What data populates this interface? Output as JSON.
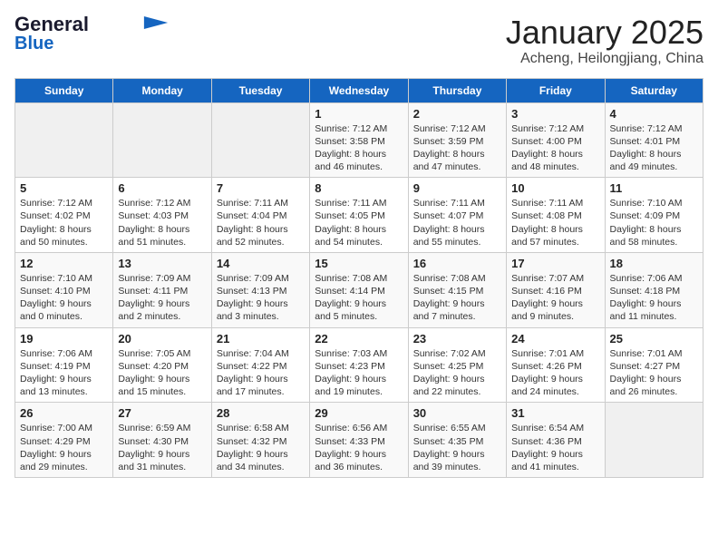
{
  "logo": {
    "line1": "General",
    "line2": "Blue"
  },
  "title": "January 2025",
  "subtitle": "Acheng, Heilongjiang, China",
  "days_of_week": [
    "Sunday",
    "Monday",
    "Tuesday",
    "Wednesday",
    "Thursday",
    "Friday",
    "Saturday"
  ],
  "weeks": [
    [
      {
        "num": "",
        "info": ""
      },
      {
        "num": "",
        "info": ""
      },
      {
        "num": "",
        "info": ""
      },
      {
        "num": "1",
        "info": "Sunrise: 7:12 AM\nSunset: 3:58 PM\nDaylight: 8 hours and 46 minutes."
      },
      {
        "num": "2",
        "info": "Sunrise: 7:12 AM\nSunset: 3:59 PM\nDaylight: 8 hours and 47 minutes."
      },
      {
        "num": "3",
        "info": "Sunrise: 7:12 AM\nSunset: 4:00 PM\nDaylight: 8 hours and 48 minutes."
      },
      {
        "num": "4",
        "info": "Sunrise: 7:12 AM\nSunset: 4:01 PM\nDaylight: 8 hours and 49 minutes."
      }
    ],
    [
      {
        "num": "5",
        "info": "Sunrise: 7:12 AM\nSunset: 4:02 PM\nDaylight: 8 hours and 50 minutes."
      },
      {
        "num": "6",
        "info": "Sunrise: 7:12 AM\nSunset: 4:03 PM\nDaylight: 8 hours and 51 minutes."
      },
      {
        "num": "7",
        "info": "Sunrise: 7:11 AM\nSunset: 4:04 PM\nDaylight: 8 hours and 52 minutes."
      },
      {
        "num": "8",
        "info": "Sunrise: 7:11 AM\nSunset: 4:05 PM\nDaylight: 8 hours and 54 minutes."
      },
      {
        "num": "9",
        "info": "Sunrise: 7:11 AM\nSunset: 4:07 PM\nDaylight: 8 hours and 55 minutes."
      },
      {
        "num": "10",
        "info": "Sunrise: 7:11 AM\nSunset: 4:08 PM\nDaylight: 8 hours and 57 minutes."
      },
      {
        "num": "11",
        "info": "Sunrise: 7:10 AM\nSunset: 4:09 PM\nDaylight: 8 hours and 58 minutes."
      }
    ],
    [
      {
        "num": "12",
        "info": "Sunrise: 7:10 AM\nSunset: 4:10 PM\nDaylight: 9 hours and 0 minutes."
      },
      {
        "num": "13",
        "info": "Sunrise: 7:09 AM\nSunset: 4:11 PM\nDaylight: 9 hours and 2 minutes."
      },
      {
        "num": "14",
        "info": "Sunrise: 7:09 AM\nSunset: 4:13 PM\nDaylight: 9 hours and 3 minutes."
      },
      {
        "num": "15",
        "info": "Sunrise: 7:08 AM\nSunset: 4:14 PM\nDaylight: 9 hours and 5 minutes."
      },
      {
        "num": "16",
        "info": "Sunrise: 7:08 AM\nSunset: 4:15 PM\nDaylight: 9 hours and 7 minutes."
      },
      {
        "num": "17",
        "info": "Sunrise: 7:07 AM\nSunset: 4:16 PM\nDaylight: 9 hours and 9 minutes."
      },
      {
        "num": "18",
        "info": "Sunrise: 7:06 AM\nSunset: 4:18 PM\nDaylight: 9 hours and 11 minutes."
      }
    ],
    [
      {
        "num": "19",
        "info": "Sunrise: 7:06 AM\nSunset: 4:19 PM\nDaylight: 9 hours and 13 minutes."
      },
      {
        "num": "20",
        "info": "Sunrise: 7:05 AM\nSunset: 4:20 PM\nDaylight: 9 hours and 15 minutes."
      },
      {
        "num": "21",
        "info": "Sunrise: 7:04 AM\nSunset: 4:22 PM\nDaylight: 9 hours and 17 minutes."
      },
      {
        "num": "22",
        "info": "Sunrise: 7:03 AM\nSunset: 4:23 PM\nDaylight: 9 hours and 19 minutes."
      },
      {
        "num": "23",
        "info": "Sunrise: 7:02 AM\nSunset: 4:25 PM\nDaylight: 9 hours and 22 minutes."
      },
      {
        "num": "24",
        "info": "Sunrise: 7:01 AM\nSunset: 4:26 PM\nDaylight: 9 hours and 24 minutes."
      },
      {
        "num": "25",
        "info": "Sunrise: 7:01 AM\nSunset: 4:27 PM\nDaylight: 9 hours and 26 minutes."
      }
    ],
    [
      {
        "num": "26",
        "info": "Sunrise: 7:00 AM\nSunset: 4:29 PM\nDaylight: 9 hours and 29 minutes."
      },
      {
        "num": "27",
        "info": "Sunrise: 6:59 AM\nSunset: 4:30 PM\nDaylight: 9 hours and 31 minutes."
      },
      {
        "num": "28",
        "info": "Sunrise: 6:58 AM\nSunset: 4:32 PM\nDaylight: 9 hours and 34 minutes."
      },
      {
        "num": "29",
        "info": "Sunrise: 6:56 AM\nSunset: 4:33 PM\nDaylight: 9 hours and 36 minutes."
      },
      {
        "num": "30",
        "info": "Sunrise: 6:55 AM\nSunset: 4:35 PM\nDaylight: 9 hours and 39 minutes."
      },
      {
        "num": "31",
        "info": "Sunrise: 6:54 AM\nSunset: 4:36 PM\nDaylight: 9 hours and 41 minutes."
      },
      {
        "num": "",
        "info": ""
      }
    ]
  ]
}
